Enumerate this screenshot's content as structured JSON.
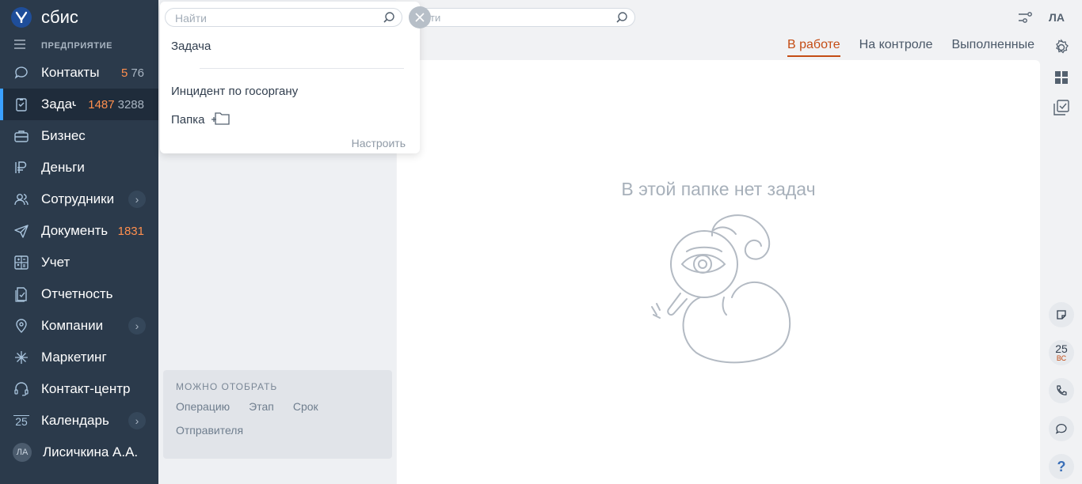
{
  "app": {
    "logo_text": "сбис",
    "section_title": "ПРЕДПРИЯТИЕ"
  },
  "sidebar": {
    "items": [
      {
        "label": "Контакты",
        "count_new": "5",
        "count_all": "76",
        "icon": "chat-bubble-icon"
      },
      {
        "label": "Задачи",
        "count_new": "1487",
        "count_all": "3288",
        "icon": "clipboard-check-icon",
        "active": true
      },
      {
        "label": "Бизнес",
        "icon": "briefcase-icon"
      },
      {
        "label": "Деньги",
        "icon": "ruble-icon"
      },
      {
        "label": "Сотрудники",
        "icon": "people-icon",
        "has_submenu": true
      },
      {
        "label": "Документы",
        "count_new": "1831",
        "icon": "paper-plane-icon"
      },
      {
        "label": "Учет",
        "icon": "calculator-icon"
      },
      {
        "label": "Отчетность",
        "icon": "report-check-icon"
      },
      {
        "label": "Компании",
        "icon": "map-pin-icon",
        "has_submenu": true
      },
      {
        "label": "Маркетинг",
        "icon": "sparkle-icon"
      },
      {
        "label": "Контакт-центр",
        "icon": "headset-icon"
      },
      {
        "label": "Календарь",
        "icon": "calendar-icon",
        "calendar_day": "25",
        "has_submenu": true
      },
      {
        "label": "Лисичкина А.А.",
        "icon": "avatar",
        "initials": "ЛА"
      }
    ]
  },
  "search": {
    "placeholder": "Найти",
    "bg_text": "ти"
  },
  "dropdown": {
    "items": [
      {
        "label": "Задача"
      },
      {
        "label": "Инцидент по госоргану"
      },
      {
        "label": "Папка"
      }
    ],
    "configure_label": "Настроить"
  },
  "tabs": [
    {
      "label": "В работе",
      "active": true
    },
    {
      "label": "На контроле"
    },
    {
      "label": "Выполненные"
    }
  ],
  "filters": {
    "title": "МОЖНО ОТОБРАТЬ",
    "links": [
      "Операцию",
      "Этап",
      "Срок",
      "Отправителя"
    ]
  },
  "content": {
    "empty_message": "В этой папке нет задач"
  },
  "header": {
    "user_initials": "ЛА"
  },
  "right_rail": {
    "calendar_day": "25",
    "calendar_weekday": "ВС"
  },
  "colors": {
    "sidebar_bg": "#2b3a4b",
    "accent": "#c44c14",
    "count_new": "#ff8f4e",
    "active_marker": "#3aa0ff"
  }
}
